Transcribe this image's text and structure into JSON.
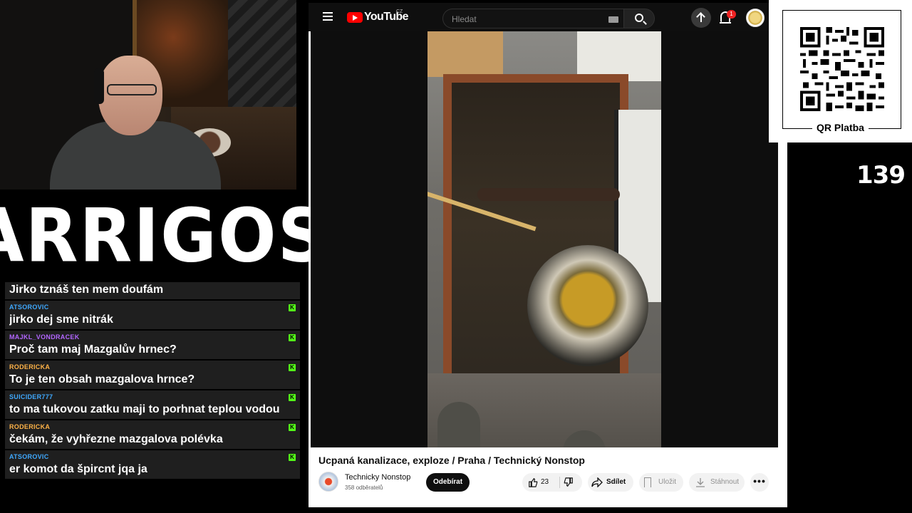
{
  "overlay": {
    "logo_text": "ARRIGOS",
    "counter": "139",
    "qr_label": "QR Platba"
  },
  "chat": {
    "messages": [
      {
        "user": "",
        "text": "Jirko tznáš ten mem doufám",
        "user_color": "#3fa9ff"
      },
      {
        "user": "ATSOROVIC",
        "text": "jirko dej sme nitrák",
        "user_color": "#3fa9ff"
      },
      {
        "user": "MAJKL_VONDRACEK",
        "text": "Proč tam maj Mazgalův hrnec?",
        "user_color": "#b266ff"
      },
      {
        "user": "RODERICKA",
        "text": "To je ten obsah mazgalova hrnce?",
        "user_color": "#ffb347"
      },
      {
        "user": "SUICIDER777",
        "text": "to ma tukovou zatku maji to porhnat teplou vodou",
        "user_color": "#3fa9ff"
      },
      {
        "user": "RODERICKA",
        "text": "čekám, že vyhřezne mazgalova polévka",
        "user_color": "#ffb347"
      },
      {
        "user": "ATSOROVIC",
        "text": "er komot da špircnt jqa ja",
        "user_color": "#3fa9ff"
      }
    ]
  },
  "youtube": {
    "logo_text": "YouTube",
    "country": "CZ",
    "search_placeholder": "Hledat",
    "notification_count": "1",
    "video_title": "Ucpaná kanalizace, exploze / Praha / Technický Nonstop",
    "channel_name": "Technicky Nonstop",
    "subscribers": "358 odběratelů",
    "subscribe_label": "Odebírat",
    "like_count": "23",
    "share_label": "Sdílet",
    "save_label": "Uložit",
    "download_label": "Stáhnout",
    "more_label": "•••"
  },
  "colors": {
    "chat_bg": "#1f1f1f",
    "kick_green": "#53fc18",
    "youtube_red": "#ff0000"
  }
}
